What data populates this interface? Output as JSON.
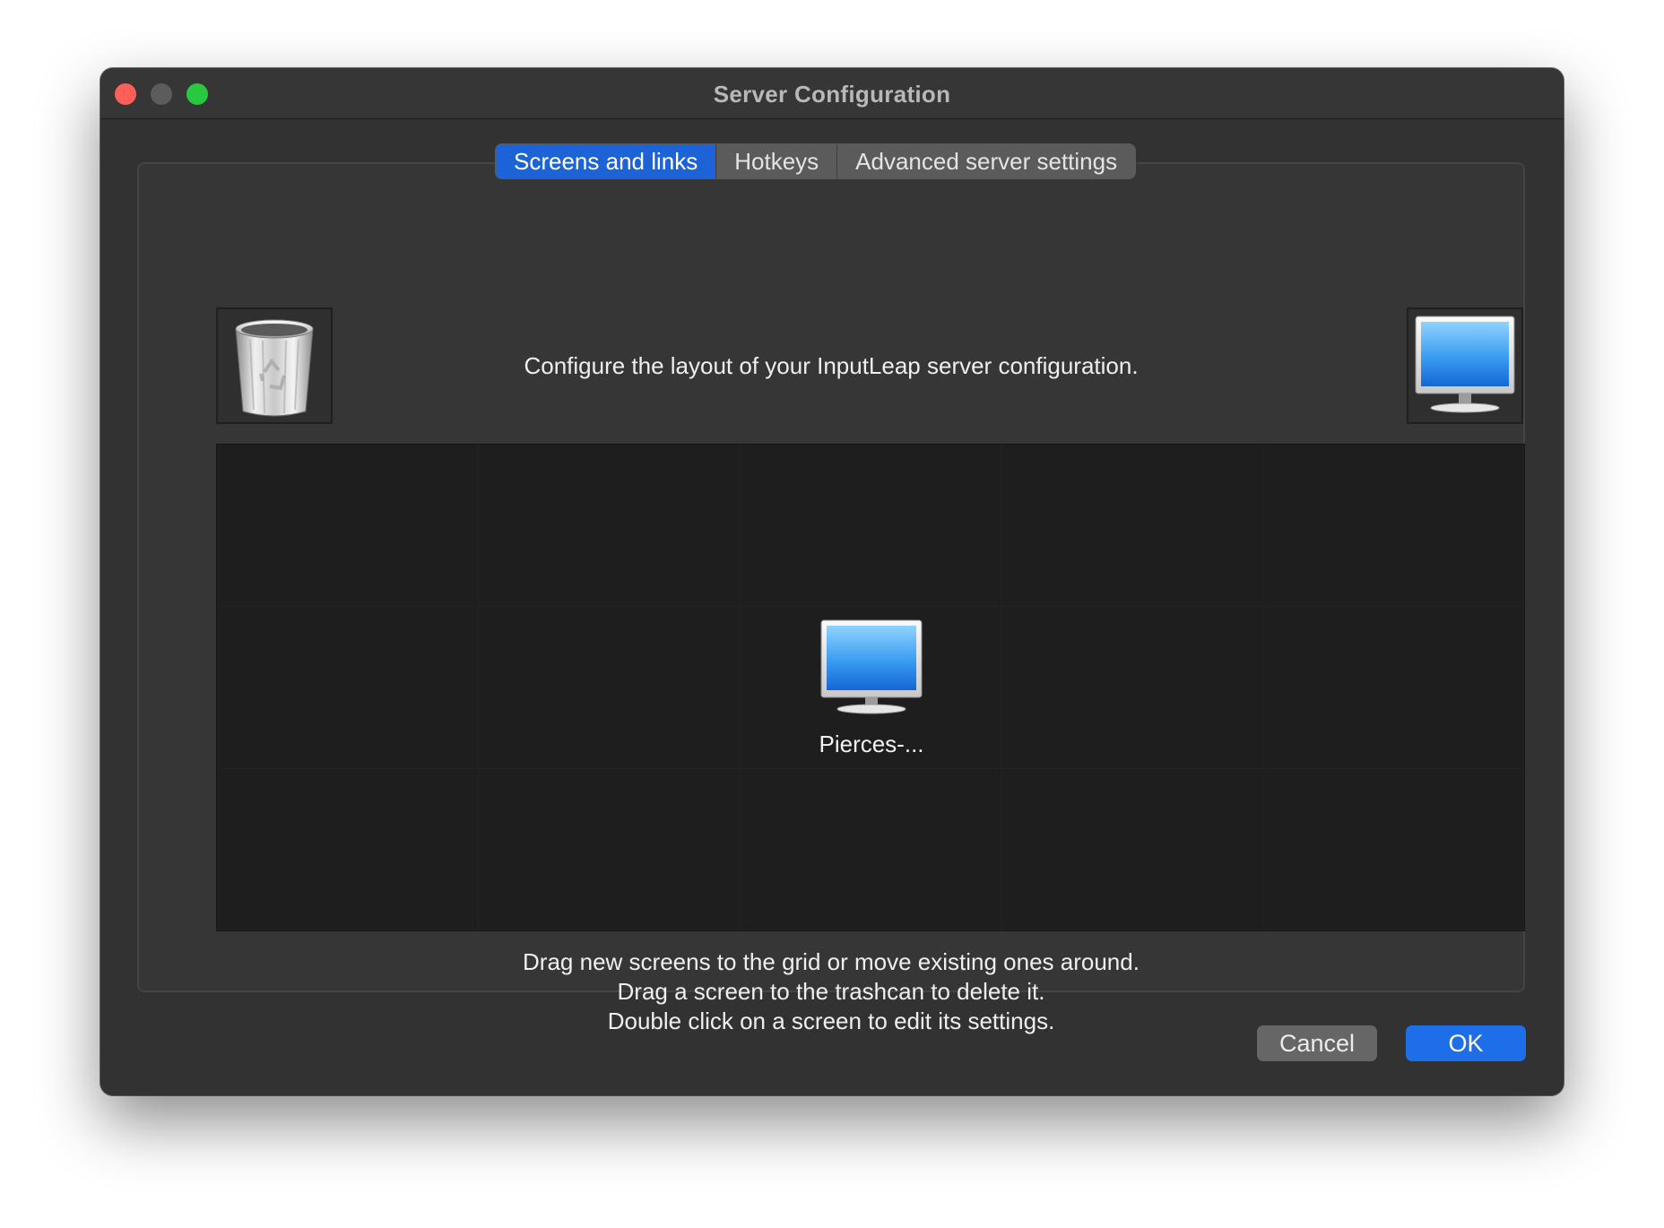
{
  "window": {
    "title": "Server Configuration"
  },
  "tabs": [
    {
      "label": "Screens and links",
      "active": true
    },
    {
      "label": "Hotkeys",
      "active": false
    },
    {
      "label": "Advanced server settings",
      "active": false
    }
  ],
  "screens_and_links": {
    "header_text": "Configure the layout of your InputLeap server configuration.",
    "trash_icon": "trash-icon",
    "new_screen_icon": "monitor-icon",
    "screens": [
      {
        "name": "Pierces-...",
        "icon": "monitor-icon"
      }
    ],
    "help_lines": [
      "Drag new screens to the grid or move existing ones around.",
      "Drag a screen to the trashcan to delete it.",
      "Double click on a screen to edit its settings."
    ]
  },
  "buttons": {
    "cancel": "Cancel",
    "ok": "OK"
  },
  "colors": {
    "accent": "#1d63d8",
    "window_bg": "#323232",
    "grid_bg": "#1e1e1e"
  }
}
